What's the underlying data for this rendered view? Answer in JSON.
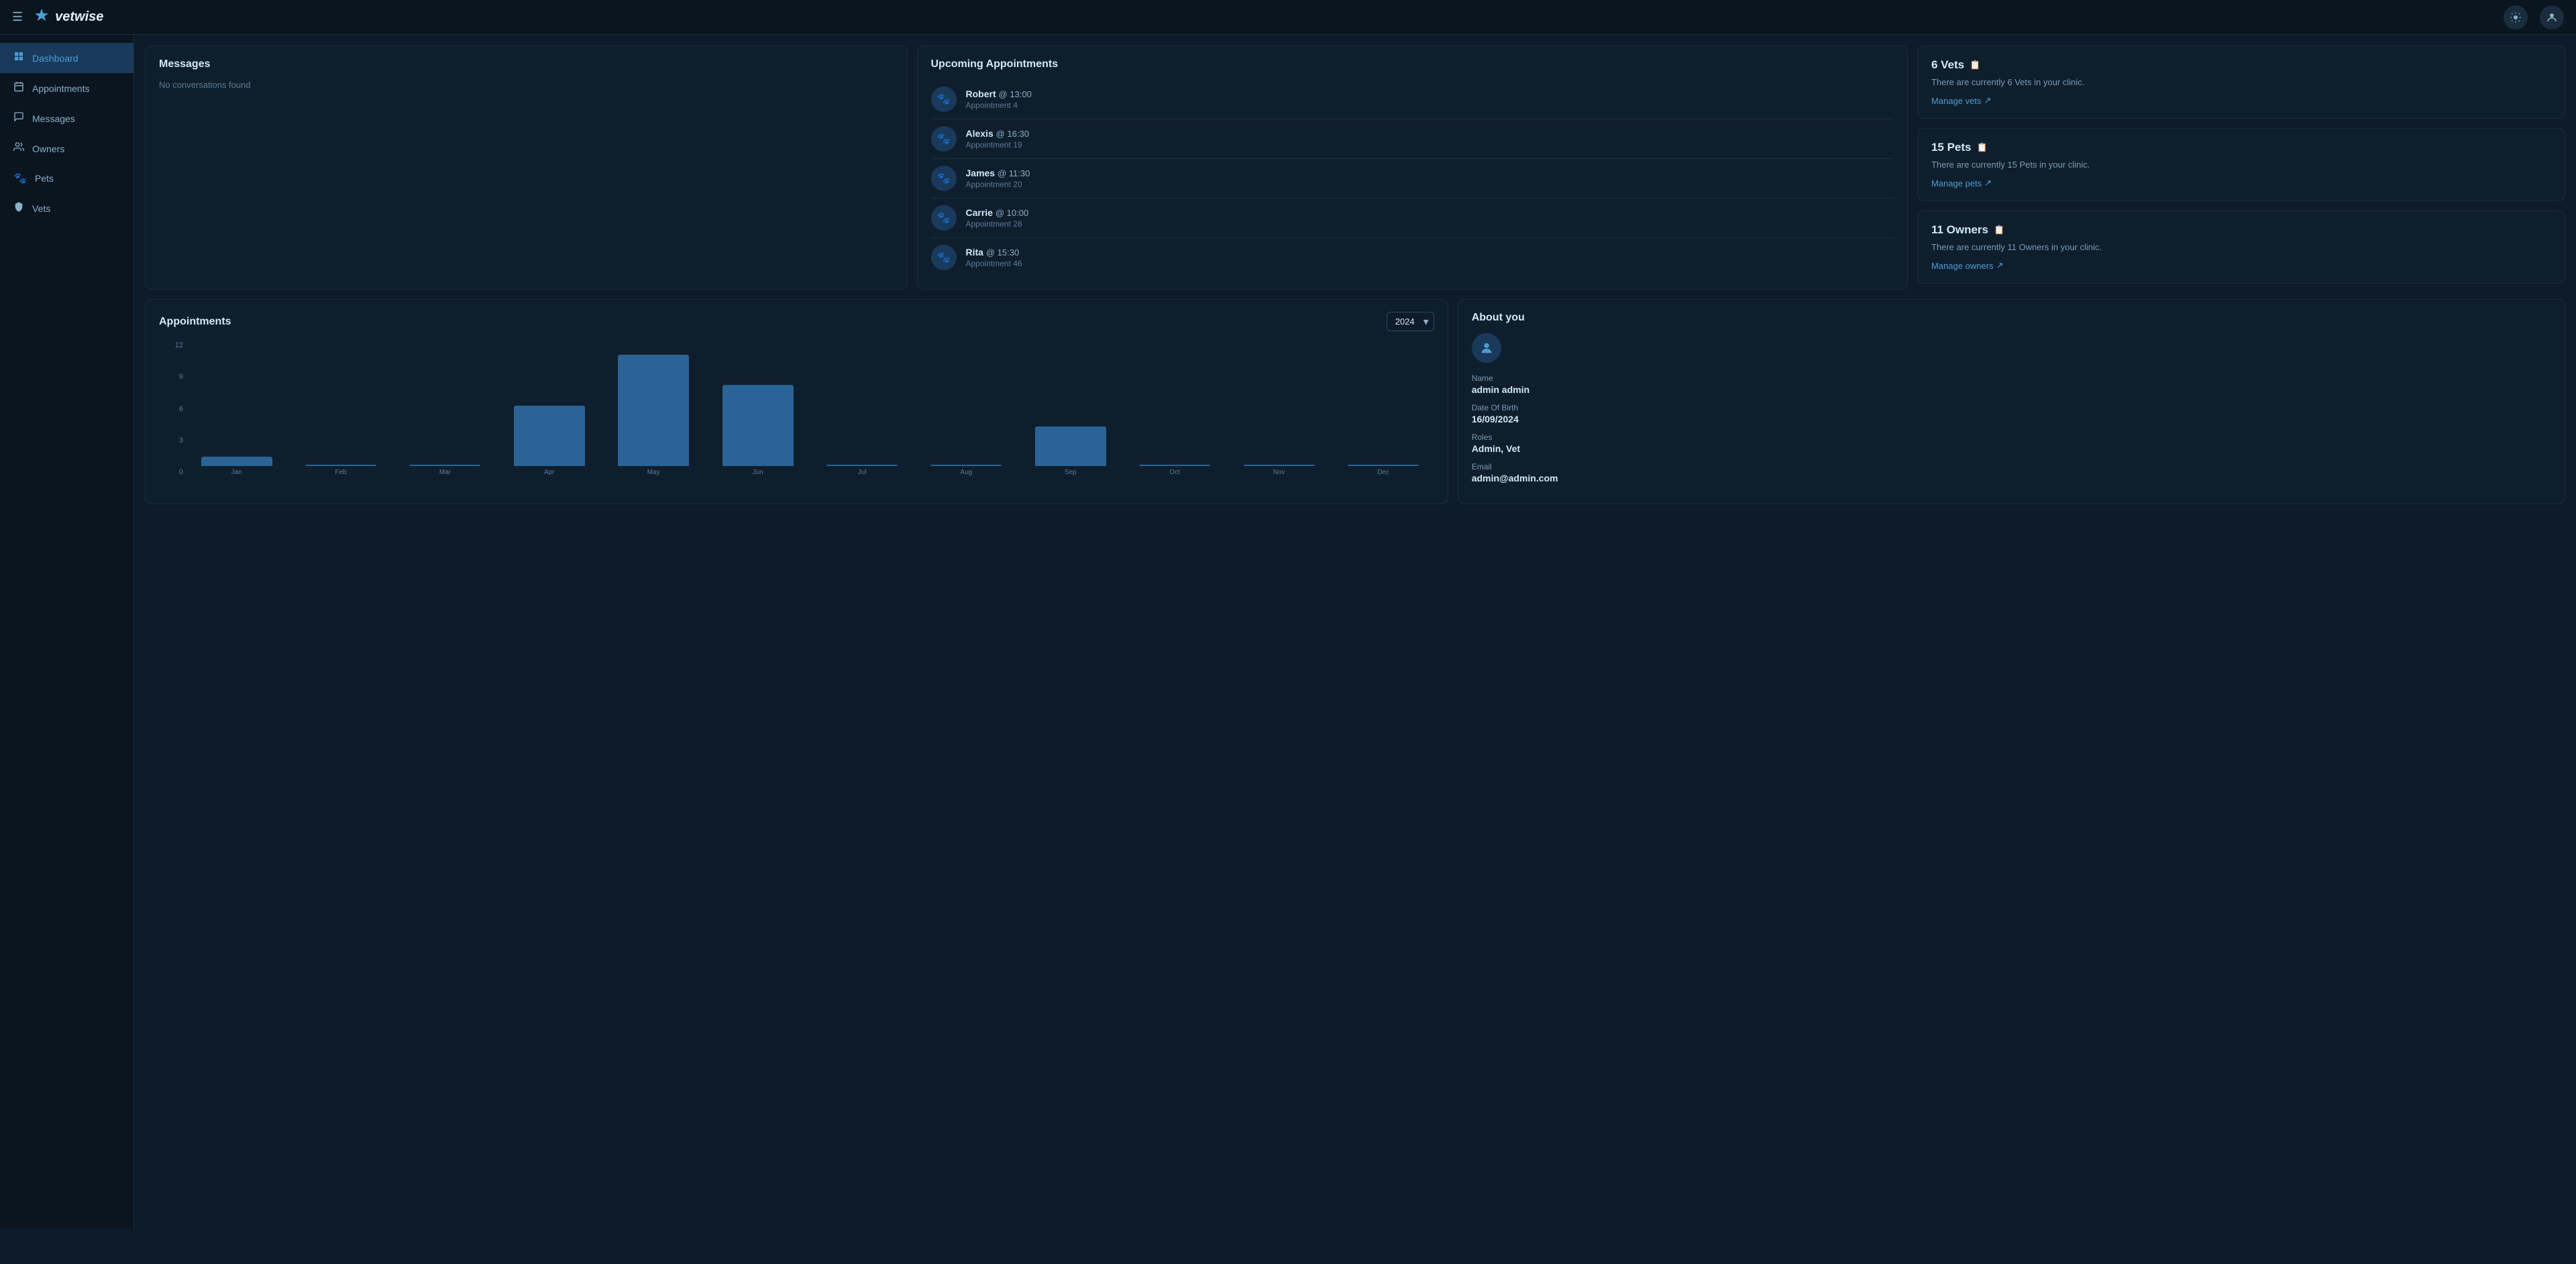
{
  "topbar": {
    "logo_text": "vetwise",
    "logo_icon": "❄",
    "hamburger_label": "☰",
    "sun_icon": "☀",
    "user_icon": "👤"
  },
  "sidebar": {
    "items": [
      {
        "id": "dashboard",
        "label": "Dashboard",
        "icon": "⊞",
        "active": true
      },
      {
        "id": "appointments",
        "label": "Appointments",
        "icon": "📅",
        "active": false
      },
      {
        "id": "messages",
        "label": "Messages",
        "icon": "💬",
        "active": false
      },
      {
        "id": "owners",
        "label": "Owners",
        "icon": "👥",
        "active": false
      },
      {
        "id": "pets",
        "label": "Pets",
        "icon": "🐾",
        "active": false
      },
      {
        "id": "vets",
        "label": "Vets",
        "icon": "🛡",
        "active": false
      }
    ]
  },
  "messages": {
    "title": "Messages",
    "empty": "No conversations found"
  },
  "upcoming": {
    "title": "Upcoming Appointments",
    "items": [
      {
        "name": "Robert",
        "time": "@ 13:00",
        "appointment": "Appointment 4"
      },
      {
        "name": "Alexis",
        "time": "@ 16:30",
        "appointment": "Appointment 19"
      },
      {
        "name": "James",
        "time": "@ 11:30",
        "appointment": "Appointment 20"
      },
      {
        "name": "Carrie",
        "time": "@ 10:00",
        "appointment": "Appointment 28"
      },
      {
        "name": "Rita",
        "time": "@ 15:30",
        "appointment": "Appointment 46"
      }
    ]
  },
  "stats": {
    "vets": {
      "title": "6 Vets",
      "desc": "There are currently 6 Vets in your clinic.",
      "link": "Manage vets"
    },
    "pets": {
      "title": "15 Pets",
      "desc": "There are currently 15 Pets in your clinic.",
      "link": "Manage pets"
    },
    "owners": {
      "title": "11 Owners",
      "desc": "There are currently 11 Owners in your clinic.",
      "link": "Manage owners"
    }
  },
  "appointments_chart": {
    "title": "Appointments",
    "year": "2024",
    "y_labels": [
      "12",
      "9",
      "6",
      "3",
      "0"
    ],
    "bars": [
      {
        "month": "Jan",
        "value": 1,
        "height_pct": 8
      },
      {
        "month": "Feb",
        "value": 0,
        "height_pct": 0
      },
      {
        "month": "Mar",
        "value": 0,
        "height_pct": 0
      },
      {
        "month": "Apr",
        "value": 6,
        "height_pct": 50
      },
      {
        "month": "May",
        "value": 11,
        "height_pct": 92
      },
      {
        "month": "Jun",
        "value": 8,
        "height_pct": 67
      },
      {
        "month": "Jul",
        "value": 0,
        "height_pct": 0
      },
      {
        "month": "Aug",
        "value": 0,
        "height_pct": 0
      },
      {
        "month": "Sep",
        "value": 4,
        "height_pct": 33
      },
      {
        "month": "Oct",
        "value": 0,
        "height_pct": 0
      },
      {
        "month": "Nov",
        "value": 0,
        "height_pct": 0
      },
      {
        "month": "Dec",
        "value": 0,
        "height_pct": 0
      }
    ]
  },
  "about": {
    "title": "About you",
    "name_label": "Name",
    "name_value": "admin admin",
    "dob_label": "Date Of Birth",
    "dob_value": "16/09/2024",
    "roles_label": "Roles",
    "roles_value": "Admin, Vet",
    "email_label": "Email",
    "email_value": "admin@admin.com"
  }
}
